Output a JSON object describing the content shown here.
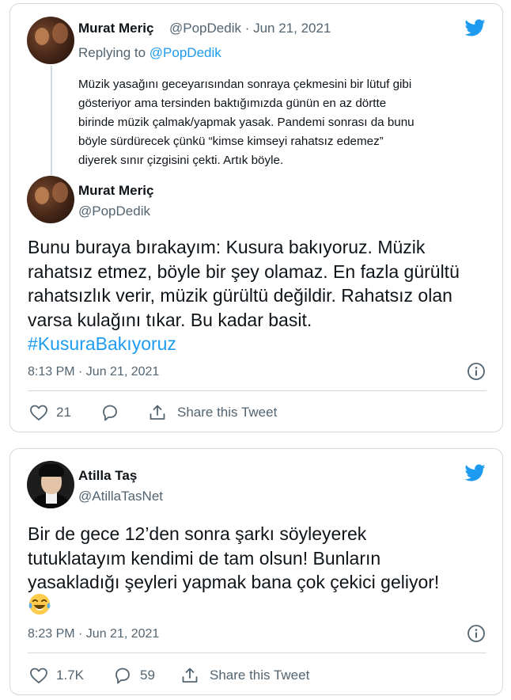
{
  "tweet1": {
    "parent": {
      "author_name": "Murat Meriç",
      "meta": "@PopDedik · Jun 21, 2021",
      "replying_prefix": "Replying to ",
      "replying_handle": "@PopDedik",
      "body_lines": [
        "Müzik yasağını geceyarısından sonraya çekmesini bir lütuf gibi",
        "gösteriyor ama tersinden baktığımızda günün en az dörtte",
        "birinde müzik çalmak/yapmak yasak. Pandemi sonrası da bunu",
        "böyle sürdürecek çünkü “kimse kimseyi rahatsız edemez”",
        "diyerek sınır çizgisini çekti. Artık böyle."
      ]
    },
    "main": {
      "author_name": "Murat Meriç",
      "handle": "@PopDedik",
      "body_lines": [
        "Bunu buraya bırakayım: Kusura bakıyoruz. Müzik",
        "rahatsız etmez, böyle bir şey olamaz. En fazla gürültü",
        "rahatsızlık verir, müzik gürültü değildir. Rahatsız olan",
        "varsa kulağını tıkar. Bu kadar basit."
      ],
      "hashtag": "#KusuraBakıyoruz",
      "timestamp": "8:13 PM · Jun 21, 2021",
      "like_count": "21",
      "share_label": "Share this Tweet"
    }
  },
  "tweet2": {
    "author_name": "Atilla Taş",
    "handle": "@AtillaTasNet",
    "body_lines": [
      "Bir de gece 12’den sonra şarkı söyleyerek",
      "tutuklatayım kendimi de tam olsun! Bunların",
      "yasakladığı şeyleri yapmak bana çok çekici geliyor!"
    ],
    "emoji": "face-with-tears-of-joy",
    "timestamp": "8:23 PM · Jun 21, 2021",
    "like_count": "1.7K",
    "reply_count": "59",
    "share_label": "Share this Tweet"
  },
  "colors": {
    "accent": "#1d9bf0",
    "text": "#0f1419",
    "muted": "#536471",
    "border": "#cfd9de"
  }
}
